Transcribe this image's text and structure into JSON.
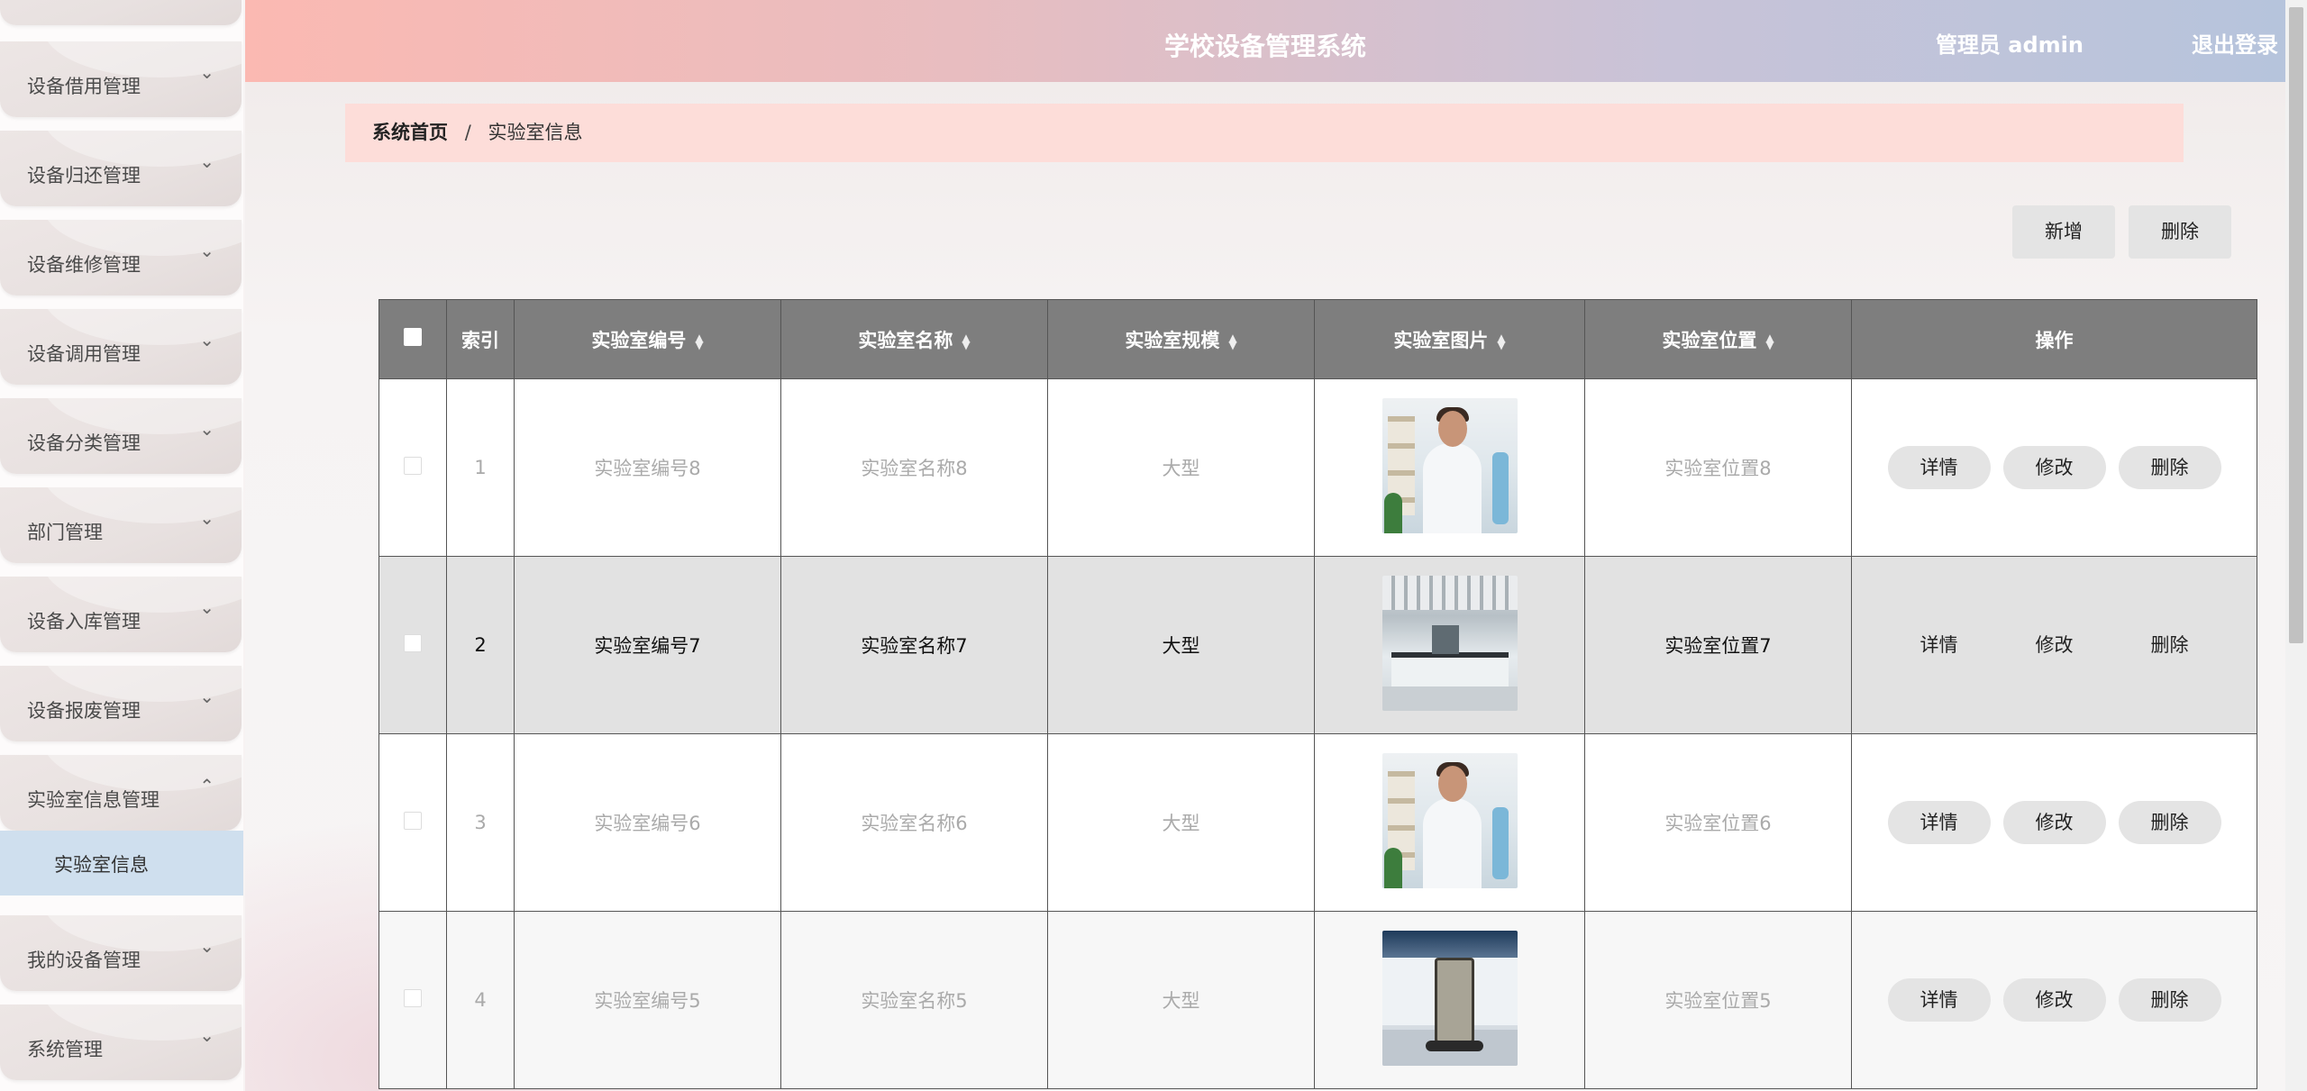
{
  "app": {
    "title": "学校设备管理系统",
    "user_label": "管理员 admin",
    "logout_label": "退出登录"
  },
  "sidebar": {
    "items": [
      {
        "label": "设备借用管理"
      },
      {
        "label": "设备归还管理"
      },
      {
        "label": "设备维修管理"
      },
      {
        "label": "设备调用管理"
      },
      {
        "label": "设备分类管理"
      },
      {
        "label": "部门管理"
      },
      {
        "label": "设备入库管理"
      },
      {
        "label": "设备报废管理"
      },
      {
        "label": "实验室信息管理"
      },
      {
        "label": "我的设备管理"
      },
      {
        "label": "系统管理"
      }
    ],
    "active_sub": "实验室信息"
  },
  "breadcrumb": {
    "home": "系统首页",
    "separator": "/",
    "current": "实验室信息"
  },
  "toolbar": {
    "add_label": "新增",
    "delete_label": "删除"
  },
  "table": {
    "headers": [
      "索引",
      "实验室编号",
      "实验室名称",
      "实验室规模",
      "实验室图片",
      "实验室位置",
      "操作"
    ],
    "rows": [
      {
        "index": "1",
        "code": "实验室编号8",
        "name": "实验室名称8",
        "scale": "大型",
        "location": "实验室位置8"
      },
      {
        "index": "2",
        "code": "实验室编号7",
        "name": "实验室名称7",
        "scale": "大型",
        "location": "实验室位置7"
      },
      {
        "index": "3",
        "code": "实验室编号6",
        "name": "实验室名称6",
        "scale": "大型",
        "location": "实验室位置6"
      },
      {
        "index": "4",
        "code": "实验室编号5",
        "name": "实验室名称5",
        "scale": "大型",
        "location": "实验室位置5"
      }
    ],
    "actions": {
      "detail": "详情",
      "edit": "修改",
      "delete": "删除"
    }
  },
  "icons": {
    "chevron_down": "chevron-down-icon",
    "chevron_up": "chevron-up-icon",
    "sort": "sort-icon"
  }
}
